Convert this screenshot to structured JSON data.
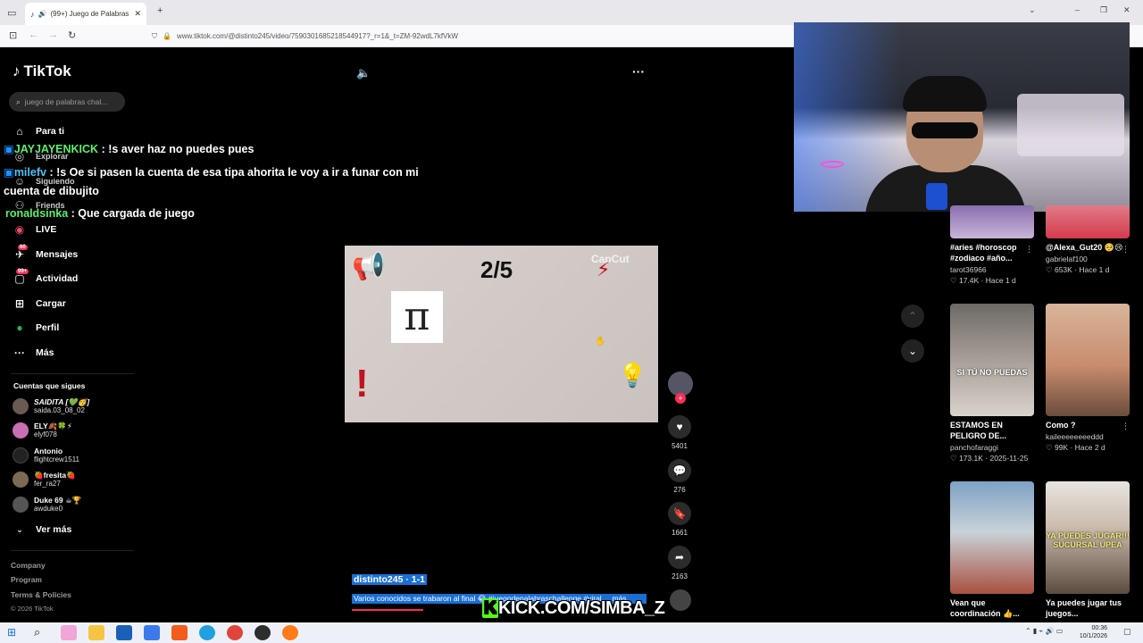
{
  "browser": {
    "tab_title": "(99+) Juego de Palabras Ch...",
    "url": "www.tiktok.com/@distinto245/video/7590301685218544917?_r=1&_t=ZM-92wdL7kfVkW"
  },
  "tiktok": {
    "logo": "TikTok",
    "search_placeholder": "juego de palabras chal...",
    "nav": [
      {
        "label": "Para ti",
        "icon": "home-icon"
      },
      {
        "label": "Explorar",
        "icon": "compass-icon"
      },
      {
        "label": "Siguiendo",
        "icon": "following-icon"
      },
      {
        "label": "Friends",
        "icon": "friends-icon"
      },
      {
        "label": "LIVE",
        "icon": "live-icon"
      },
      {
        "label": "Mensajes",
        "icon": "messages-icon",
        "badge": "60"
      },
      {
        "label": "Actividad",
        "icon": "activity-icon",
        "badge": "99+"
      },
      {
        "label": "Cargar",
        "icon": "upload-icon"
      },
      {
        "label": "Perfil",
        "icon": "profile-icon"
      },
      {
        "label": "Más",
        "icon": "more-icon"
      }
    ],
    "following_title": "Cuentas que sigues",
    "following": [
      {
        "name": "SAIDITA [💚🥳]",
        "handle": "saida.03_08_02"
      },
      {
        "name": "ELY🍂🍀⚡",
        "handle": "elyf078"
      },
      {
        "name": "Antonio",
        "handle": "flightcrew1511"
      },
      {
        "name": "🍓fresita🍓",
        "handle": "fer_ra27"
      },
      {
        "name": "Duke 69 ☕🏆",
        "handle": "awduke0"
      }
    ],
    "see_more": "Ver más",
    "footer": [
      "Company",
      "Program",
      "Terms & Policies",
      "© 2026 TikTok"
    ]
  },
  "chat": [
    {
      "user": "JAYJAYENKICK",
      "text": ": !s aver haz no puedes pues"
    },
    {
      "user": "milefv",
      "text": ": !s Oe si pasen la cuenta de esa tipa ahorita le voy a ir a funar con mi"
    },
    {
      "user": "",
      "text": "cuenta de dibujito"
    },
    {
      "user": "ronaldsinka",
      "text": ": Que cargada de juego"
    }
  ],
  "video": {
    "counter": "2/5",
    "watermark": "CapCut",
    "pi_symbol": "π",
    "exclamation": "!",
    "author_line": "distinto245 · 1-1",
    "caption": "Varios conocidos se trabaron al final 😂 #juegodepalabraschallenge #viral ... más",
    "actions": {
      "likes": "5401",
      "comments": "276",
      "saves": "1661",
      "shares": "2163"
    }
  },
  "overlay": {
    "kick": "KICK.COM/SIMBA_Z",
    "kick_mark": "K"
  },
  "grid": [
    {
      "title": "#aries #horoscop #zodiaco #año...",
      "user": "tarot36966",
      "stats": "♡ 17.4K · Hace 1 d",
      "overlay": ""
    },
    {
      "title": "@Alexa_Gut20 🥺😢",
      "user": "gabrielaf100",
      "stats": "♡ 653K · Hace 1 d",
      "overlay": ""
    },
    {
      "title": "ESTAMOS EN PELIGRO DE...",
      "user": "panchofaraggi",
      "stats": "♡ 173.1K · 2025-11-25",
      "overlay": "SI TÚ NO PUEDAS"
    },
    {
      "title": "Como ?",
      "user": "kaileeeeeeeeddd",
      "stats": "♡ 99K · Hace 2 d",
      "overlay": ""
    },
    {
      "title": "Vean que coordinación 👍...",
      "user": "",
      "stats": "",
      "overlay": ""
    },
    {
      "title": "Ya puedes jugar tus juegos...",
      "user": "",
      "stats": "",
      "overlay": "YA PUEDES JUGAR!!! SUCURSAL UPEA"
    }
  ],
  "taskbar": {
    "time": "00:36",
    "date": "10/1/2026"
  }
}
